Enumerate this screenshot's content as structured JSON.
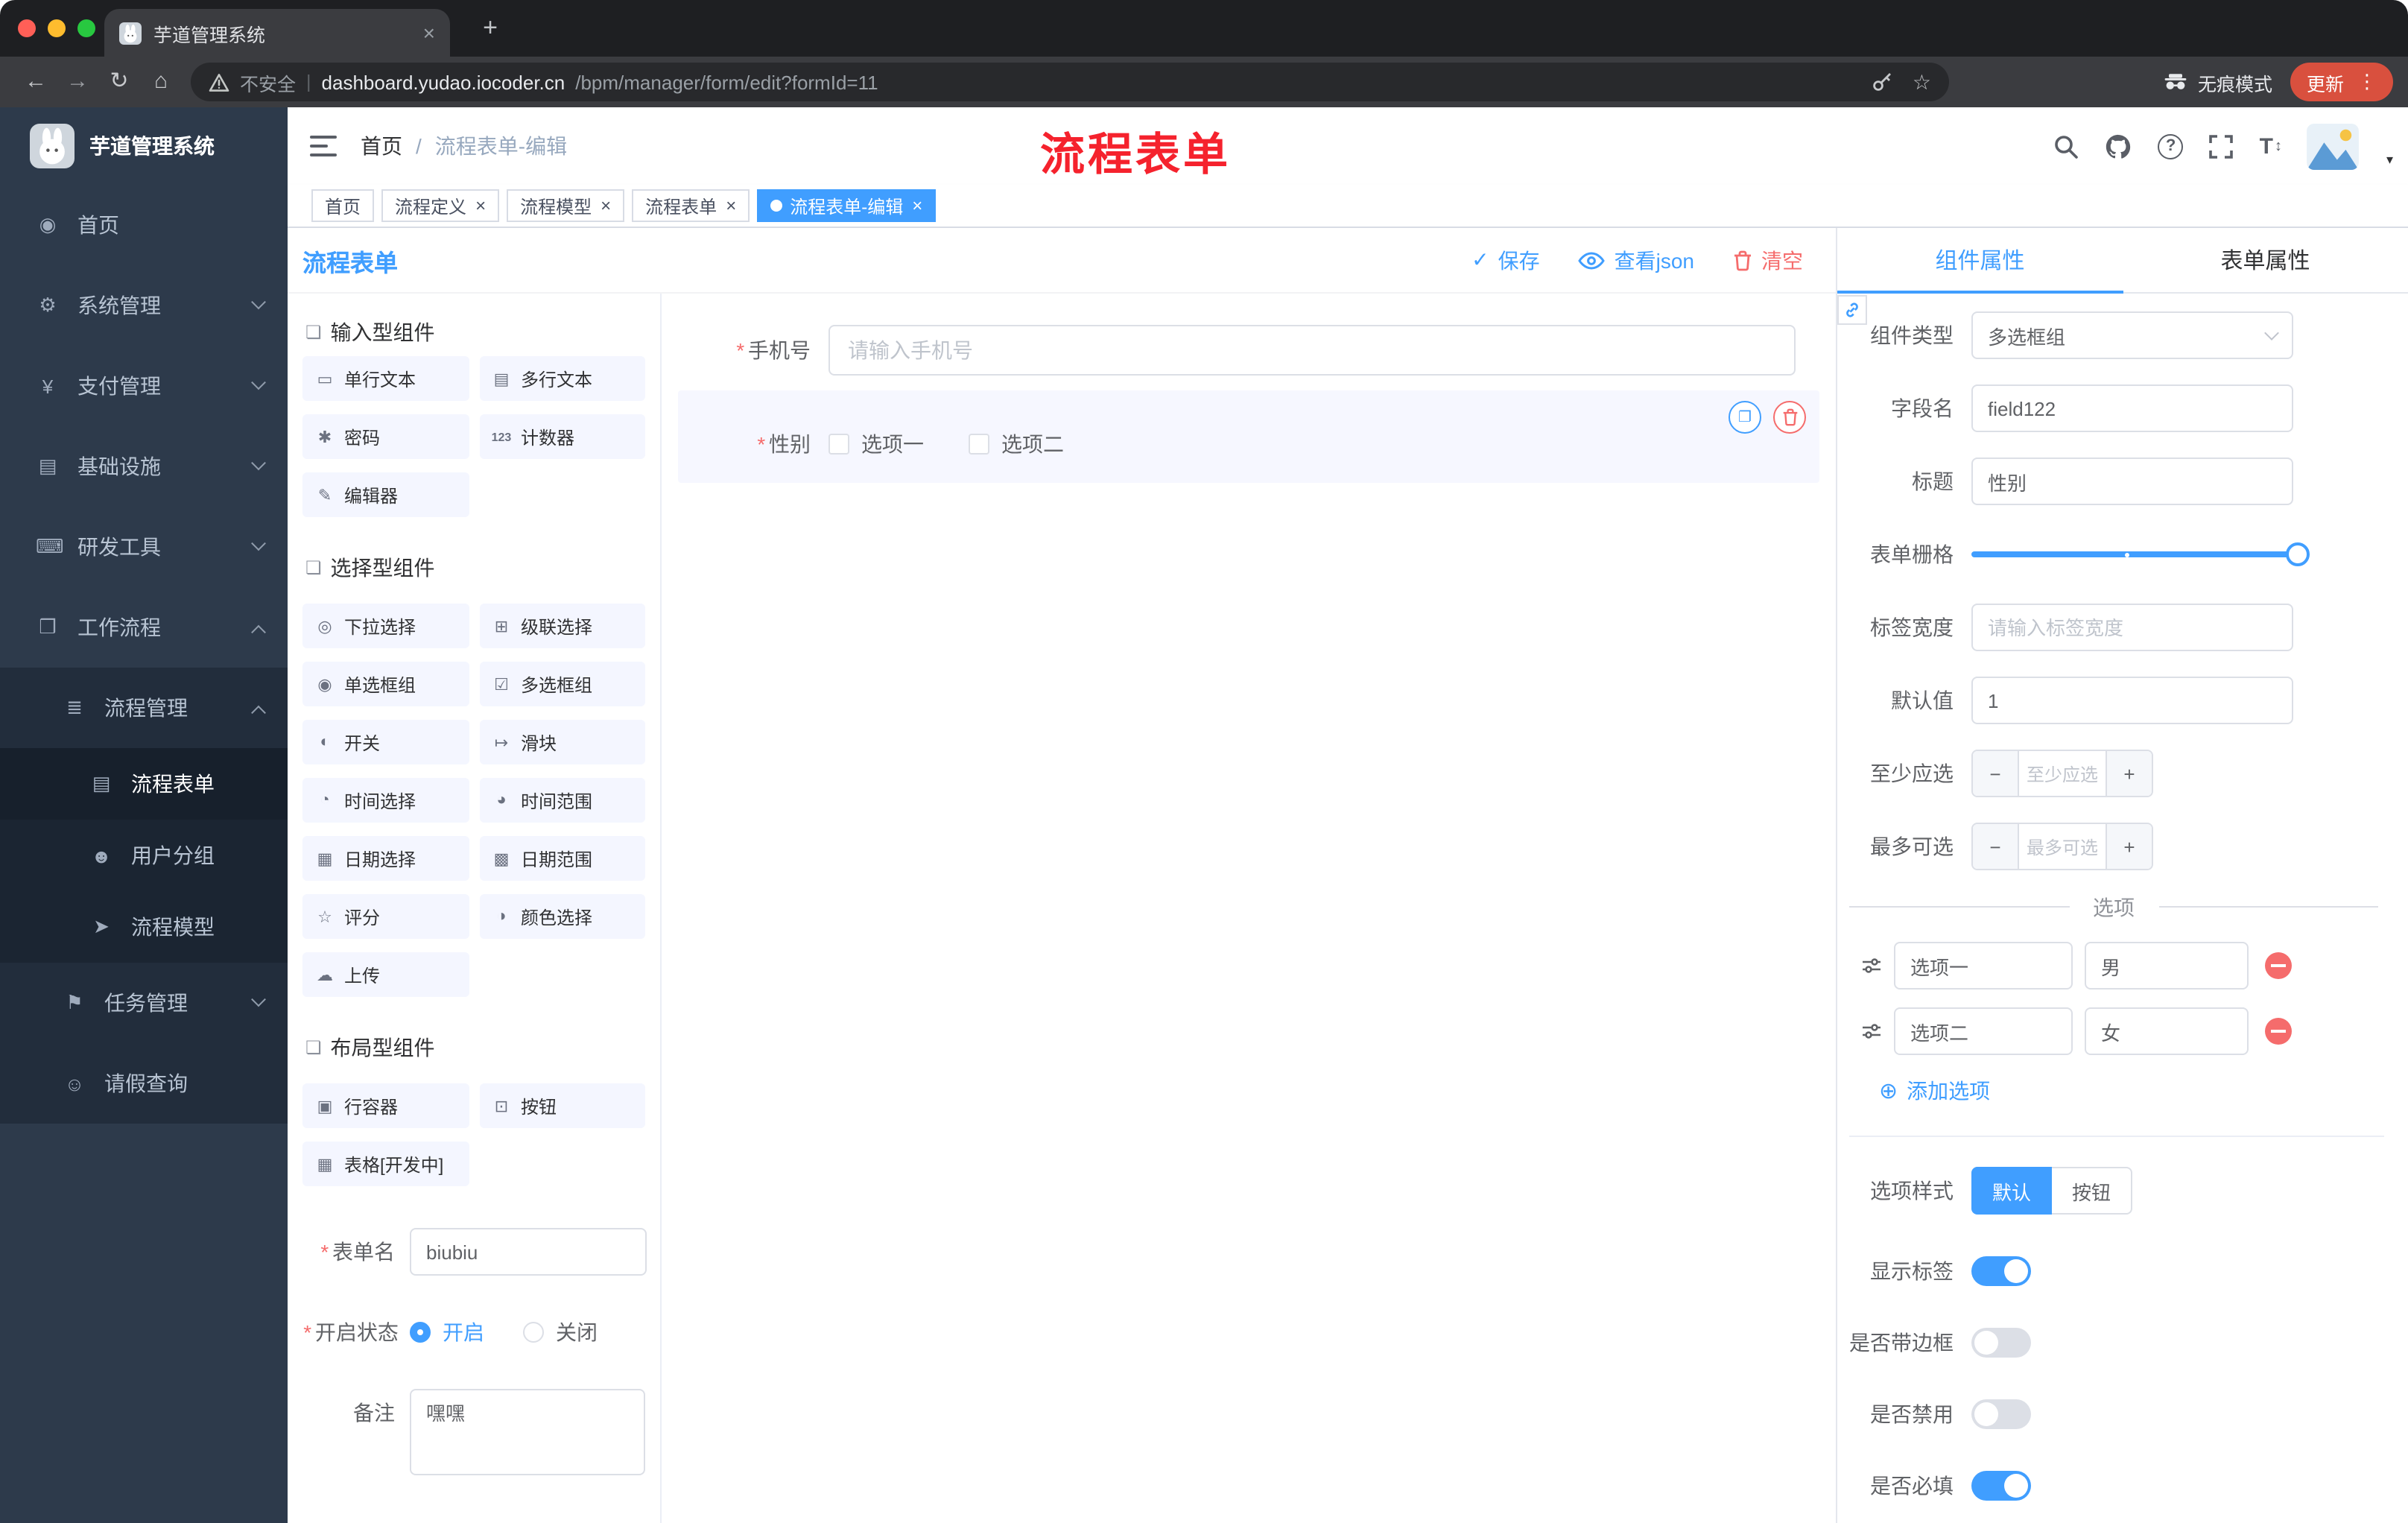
{
  "annotation": {
    "text": "流程表单",
    "color": "#f5222d"
  },
  "misc": {
    "required_glyph": "*",
    "caret_glyph": "▾"
  },
  "colors": {
    "primary": "#409eff",
    "danger": "#f56c6c",
    "sidebar_bg": "#2d3a4b",
    "update_badge": "#d9503e"
  },
  "browser": {
    "tab_title": "芋道管理系统",
    "close_glyph": "×",
    "new_tab_glyph": "+",
    "back_glyph": "←",
    "forward_glyph": "→",
    "reload_glyph": "↻",
    "home_glyph": "⌂",
    "security_label": "不安全",
    "divider_glyph": "|",
    "url_domain": "dashboard.yudao.iocoder.cn",
    "url_path": "/bpm/manager/form/edit?formId=11",
    "star_glyph": "☆",
    "incognito_label": "无痕模式",
    "update_label": "更新",
    "menu_glyph": "⋮"
  },
  "sidebar": {
    "logo_title": "芋道管理系统",
    "items": [
      {
        "label": "首页",
        "icon": "◉"
      },
      {
        "label": "系统管理",
        "icon": "⚙"
      },
      {
        "label": "支付管理",
        "icon": "¥"
      },
      {
        "label": "基础设施",
        "icon": "▤"
      },
      {
        "label": "研发工具",
        "icon": "⌨"
      },
      {
        "label": "工作流程",
        "icon": "❒"
      }
    ],
    "process_group": {
      "label": "流程管理",
      "icon": "≣"
    },
    "process_children": [
      {
        "label": "流程表单",
        "icon": "▤"
      },
      {
        "label": "用户分组",
        "icon": "☻"
      },
      {
        "label": "流程模型",
        "icon": "➤"
      }
    ],
    "task_group": {
      "label": "任务管理",
      "icon": "⚑"
    },
    "leave_item": {
      "label": "请假查询",
      "icon": "☺"
    }
  },
  "header": {
    "breadcrumb_home": "首页",
    "separator": "/",
    "breadcrumb_current": "流程表单-编辑",
    "help_glyph": "?",
    "fontsize_glyph": "T",
    "fontsize_arrow_glyph": "↕"
  },
  "tags": {
    "close_glyph": "×",
    "items": [
      {
        "label": "首页"
      },
      {
        "label": "流程定义"
      },
      {
        "label": "流程模型"
      },
      {
        "label": "流程表单"
      },
      {
        "label": "流程表单-编辑"
      }
    ]
  },
  "designer": {
    "title": "流程表单",
    "check_glyph": "✓",
    "save_label": "保存",
    "view_json_label": "查看json",
    "clear_label": "清空"
  },
  "palette": {
    "section_icon": "❏",
    "sections": [
      {
        "title": "输入型组件",
        "items": [
          {
            "label": "单行文本",
            "icon": "▭"
          },
          {
            "label": "多行文本",
            "icon": "▤"
          },
          {
            "label": "密码",
            "icon": "✱"
          },
          {
            "label": "计数器",
            "icon": "123"
          },
          {
            "label": "编辑器",
            "icon": "✎"
          }
        ]
      },
      {
        "title": "选择型组件",
        "items": [
          {
            "label": "下拉选择",
            "icon": "◎"
          },
          {
            "label": "级联选择",
            "icon": "⊞"
          },
          {
            "label": "单选框组",
            "icon": "◉"
          },
          {
            "label": "多选框组",
            "icon": "☑"
          },
          {
            "label": "开关",
            "icon": "◐"
          },
          {
            "label": "滑块",
            "icon": "↦"
          },
          {
            "label": "时间选择",
            "icon": "◔"
          },
          {
            "label": "时间范围",
            "icon": "◕"
          },
          {
            "label": "日期选择",
            "icon": "▦"
          },
          {
            "label": "日期范围",
            "icon": "▩"
          },
          {
            "label": "评分",
            "icon": "☆"
          },
          {
            "label": "颜色选择",
            "icon": "◑"
          },
          {
            "label": "上传",
            "icon": "☁"
          }
        ]
      },
      {
        "title": "布局型组件",
        "items": [
          {
            "label": "行容器",
            "icon": "▣"
          },
          {
            "label": "按钮",
            "icon": "⊡"
          },
          {
            "label": "表格[开发中]",
            "icon": "▦"
          }
        ]
      }
    ]
  },
  "meta": {
    "form_name_label": "表单名",
    "form_name_value": "biubiu",
    "status_label": "开启状态",
    "status_on": "开启",
    "status_off": "关闭",
    "remark_label": "备注",
    "remark_value": "嘿嘿"
  },
  "canvas": {
    "phone_label": "手机号",
    "phone_placeholder": "请输入手机号",
    "gender_label": "性别",
    "gender_option1": "选项一",
    "gender_option2": "选项二",
    "copy_glyph": "❐"
  },
  "panel": {
    "tab_component": "组件属性",
    "tab_form": "表单属性",
    "component_type_label": "组件类型",
    "component_type_value": "多选框组",
    "field_name_label": "字段名",
    "field_name_value": "field122",
    "title_label": "标题",
    "title_value": "性别",
    "grid_label": "表单栅格",
    "label_width_label": "标签宽度",
    "label_width_placeholder": "请输入标签宽度",
    "default_label": "默认值",
    "default_value": "1",
    "min_label": "至少应选",
    "min_placeholder": "至少应选",
    "max_label": "最多可选",
    "max_placeholder": "最多可选",
    "minus_glyph": "−",
    "plus_glyph": "+",
    "options_title": "选项",
    "option_rows": [
      {
        "name": "选项一",
        "value": "男"
      },
      {
        "name": "选项二",
        "value": "女"
      }
    ],
    "add_glyph": "⊕",
    "add_option_label": "添加选项",
    "style_label": "选项样式",
    "style_default": "默认",
    "style_button": "按钮",
    "toggle_show_label": "显示标签",
    "toggle_border_label": "是否带边框",
    "toggle_disabled_label": "是否禁用",
    "toggle_required_label": "是否必填"
  }
}
